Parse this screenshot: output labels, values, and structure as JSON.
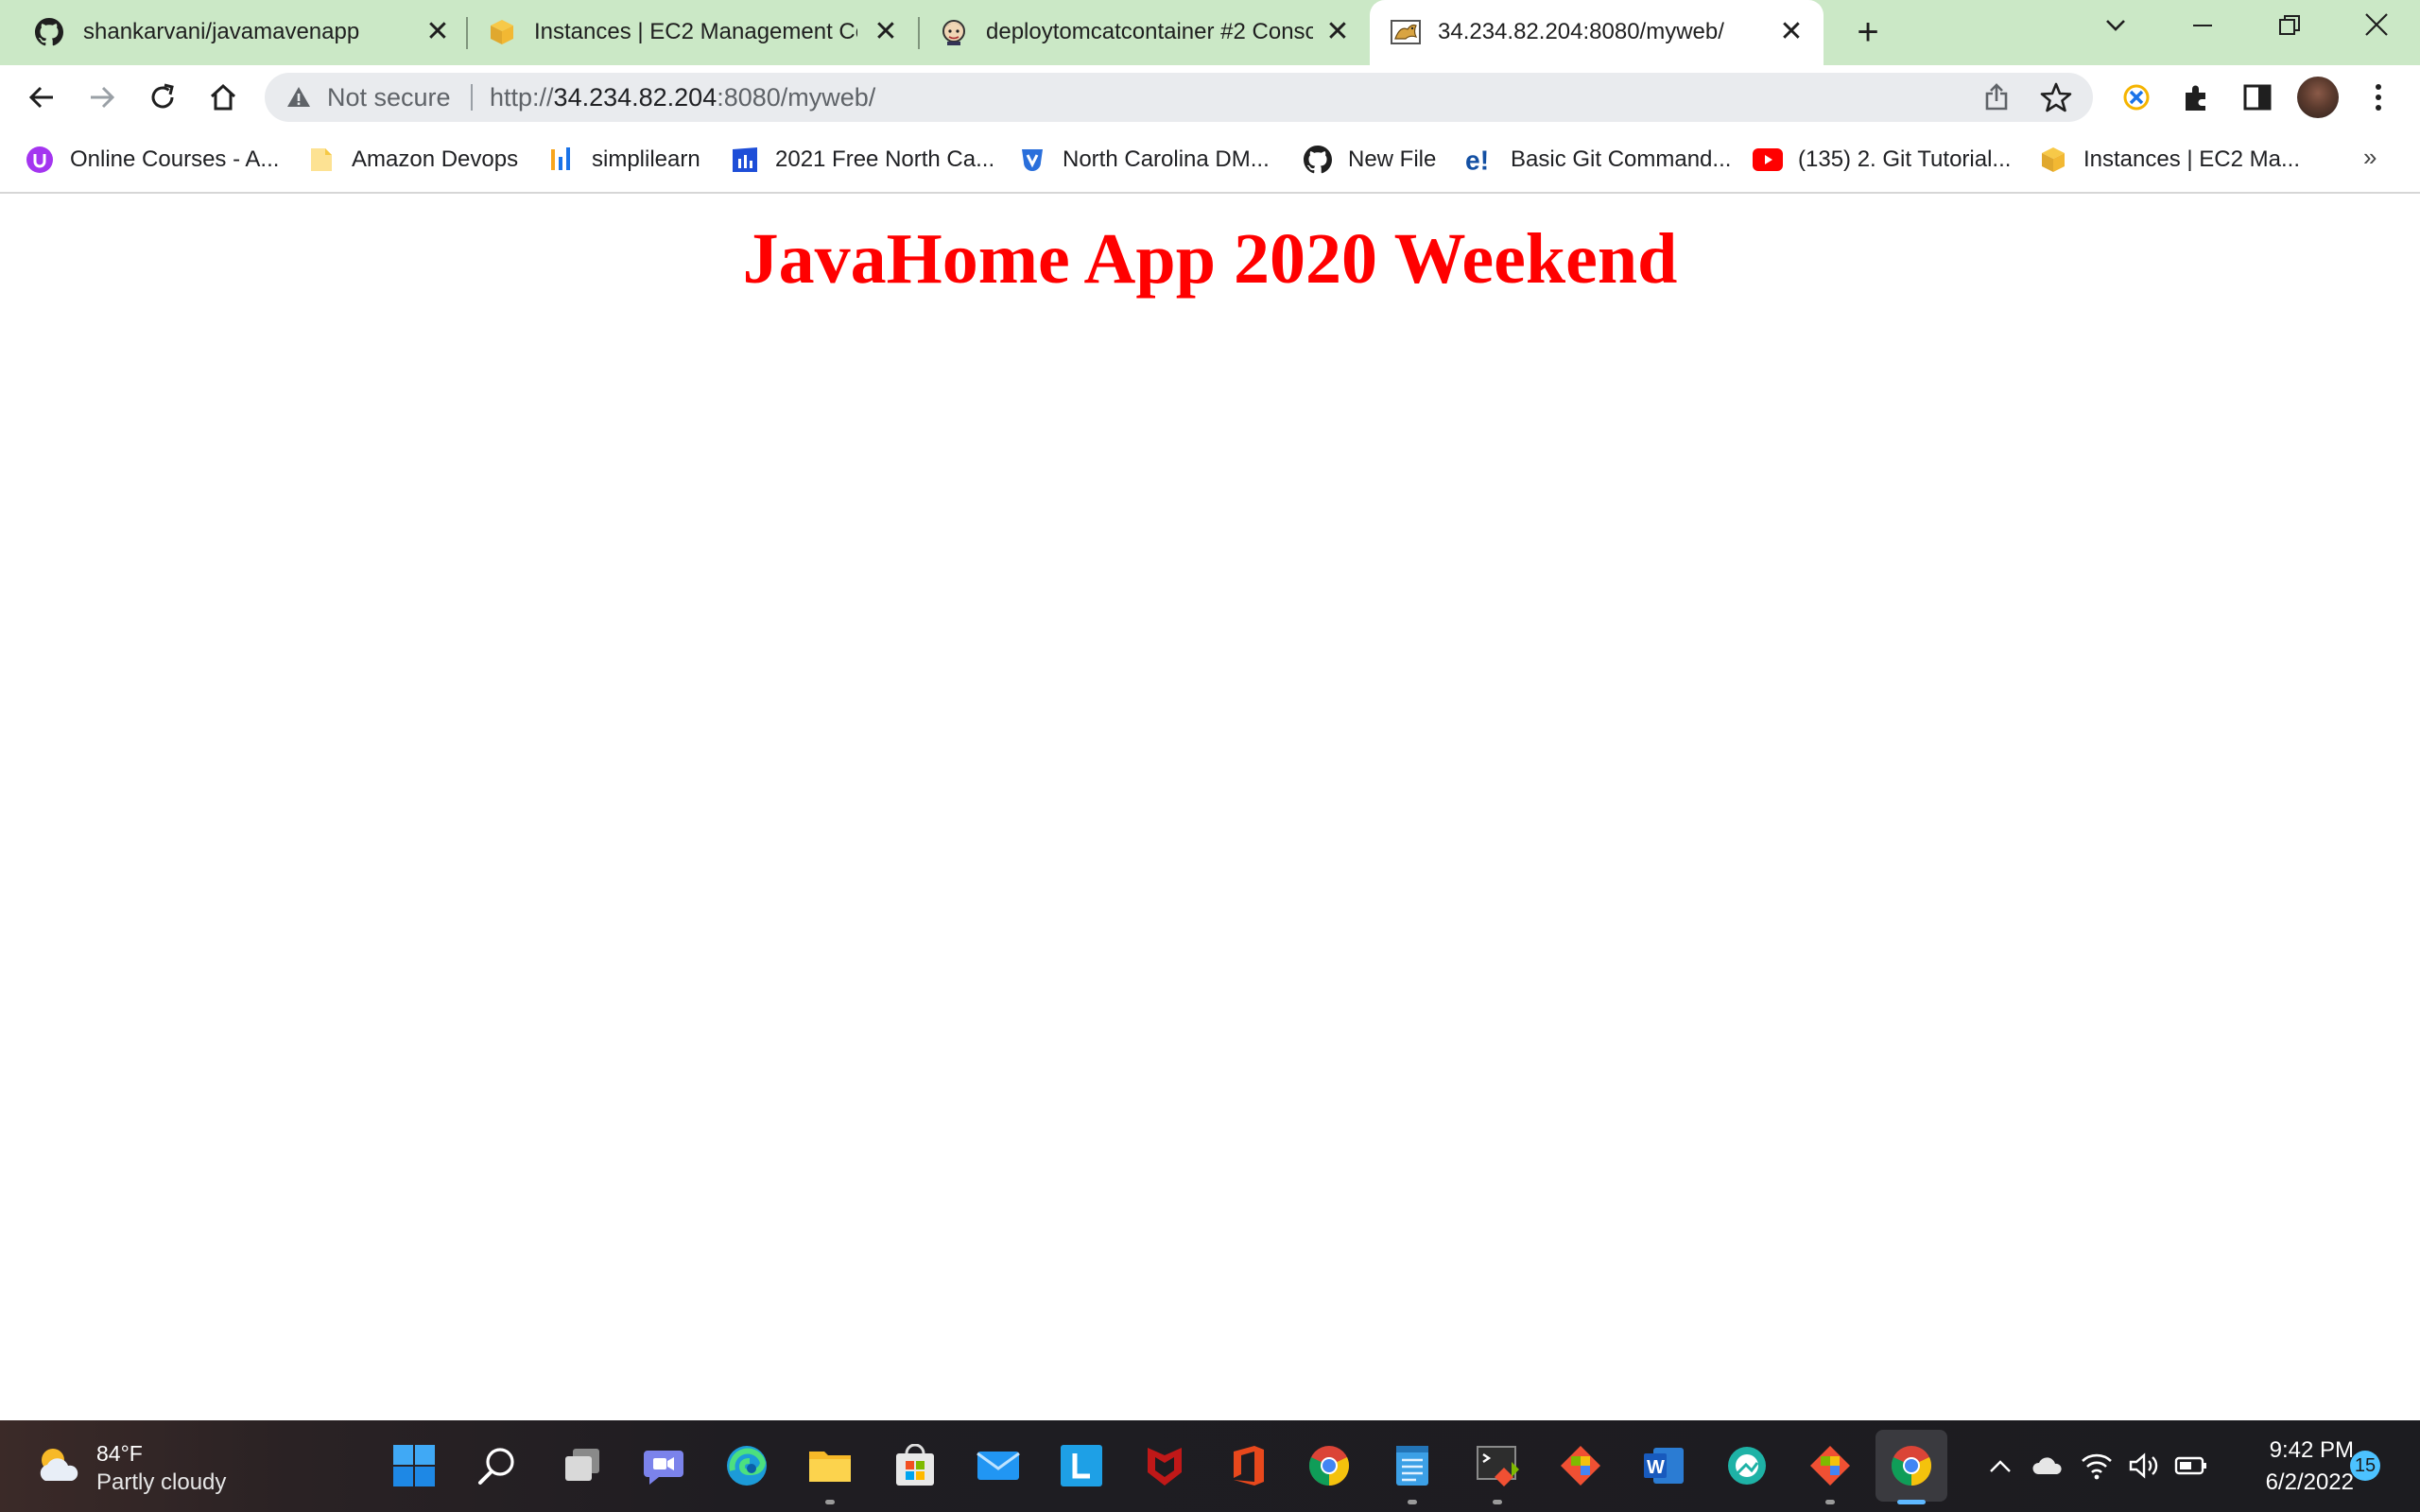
{
  "browser": {
    "tabs": [
      {
        "title": "shankarvani/javamavenapp",
        "favicon": "github-icon"
      },
      {
        "title": "Instances | EC2 Management Console",
        "favicon": "aws-box-icon"
      },
      {
        "title": "deploytomcatcontainer #2 Console",
        "favicon": "jenkins-icon"
      },
      {
        "title": "34.234.82.204:8080/myweb/",
        "favicon": "tomcat-icon",
        "active": true
      }
    ],
    "tab_close_glyph": "✕",
    "new_tab_glyph": "+",
    "address_bar": {
      "security_label": "Not secure",
      "url_scheme": "http://",
      "url_host": "34.234.82.204",
      "url_rest": ":8080/myweb/"
    },
    "bookmarks": [
      {
        "label": "Online Courses - A...",
        "icon": "udemy-icon"
      },
      {
        "label": "Amazon Devops",
        "icon": "folder-icon"
      },
      {
        "label": "simplilearn",
        "icon": "simplilearn-icon"
      },
      {
        "label": "2021 Free North Ca...",
        "icon": "test-site-icon"
      },
      {
        "label": "North Carolina DM...",
        "icon": "dmv-icon"
      },
      {
        "label": "New File",
        "icon": "github-icon"
      },
      {
        "label": "Basic Git Command...",
        "icon": "edureka-icon"
      },
      {
        "label": "(135) 2. Git Tutorial...",
        "icon": "youtube-icon"
      },
      {
        "label": "Instances | EC2 Ma...",
        "icon": "aws-box-icon"
      }
    ],
    "bookmarks_overflow_glyph": "»"
  },
  "page": {
    "heading": "JavaHome App 2020 Weekend",
    "heading_color": "#ff0000"
  },
  "taskbar": {
    "weather": {
      "temperature": "84°F",
      "condition": "Partly cloudy"
    },
    "clock": {
      "time": "9:42 PM",
      "date": "6/2/2022"
    },
    "notification_count": "15",
    "accent_color": "#4cc2ff"
  }
}
